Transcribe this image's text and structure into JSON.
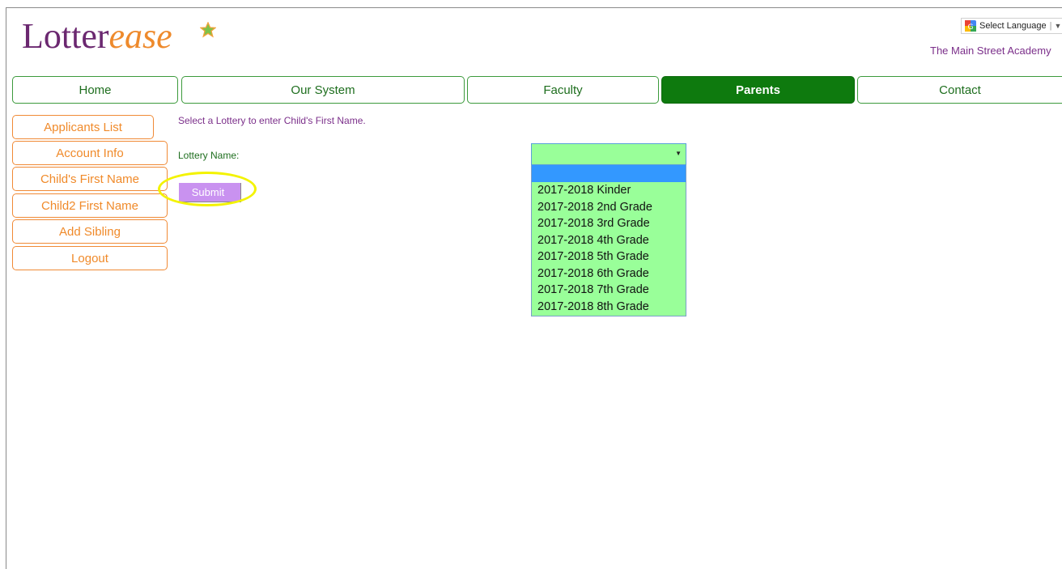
{
  "logo": {
    "part1": "Lotter",
    "part2": "ease"
  },
  "language": {
    "label": "Select Language",
    "separator": "|",
    "arrow": "▼"
  },
  "school_name": "The Main Street Academy",
  "nav": {
    "items": [
      {
        "label": "Home"
      },
      {
        "label": "Our System"
      },
      {
        "label": "Faculty"
      },
      {
        "label": "Parents"
      },
      {
        "label": "Contact"
      }
    ],
    "active": "Parents"
  },
  "sidebar": {
    "items": [
      {
        "label": "Applicants List"
      },
      {
        "label": "Account Info"
      },
      {
        "label": "Child's First Name"
      },
      {
        "label": "Child2 First Name"
      },
      {
        "label": "Add Sibling"
      },
      {
        "label": "Logout"
      }
    ]
  },
  "form": {
    "instruction": "Select a Lottery to enter Child's First Name.",
    "lottery_label": "Lottery Name:",
    "selected_value": "",
    "submit_label": "Submit",
    "options": [
      "",
      "2017-2018 Kinder",
      "2017-2018 2nd Grade",
      "2017-2018 3rd Grade",
      "2017-2018 4th Grade",
      "2017-2018 5th Grade",
      "2017-2018 6th Grade",
      "2017-2018 7th Grade",
      "2017-2018 8th Grade"
    ],
    "highlighted_option_index": 0
  },
  "colors": {
    "nav_active_bg": "#0e7a0e",
    "nav_border": "#3c9a3c",
    "sidebar_accent": "#f08a2a",
    "select_bg": "#99ff99",
    "dropdown_highlight": "#3398ff",
    "submit_bg": "#c992f0",
    "annotation_ring": "#f3f300",
    "purple_text": "#7b2f8a"
  },
  "icons": {
    "logo_star": "star-icon",
    "language": "google-translate-icon",
    "select_caret": "caret-down-icon"
  }
}
